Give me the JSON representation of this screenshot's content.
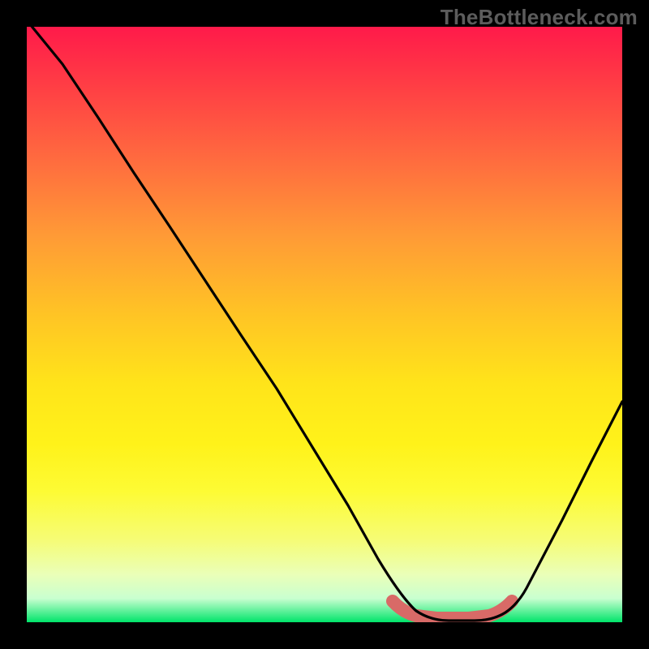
{
  "watermark": "TheBottleneck.com",
  "chart_data": {
    "type": "line",
    "title": "",
    "xlabel": "",
    "ylabel": "",
    "xlim": [
      0,
      100
    ],
    "ylim": [
      0,
      100
    ],
    "series": [
      {
        "name": "bottleneck-curve",
        "x": [
          0,
          6,
          12,
          18,
          24,
          30,
          36,
          42,
          48,
          54,
          59,
          63,
          67,
          71,
          75,
          79,
          82,
          86,
          90,
          94,
          100
        ],
        "values": [
          100,
          93,
          84,
          75,
          66,
          57,
          48,
          39,
          29,
          19,
          10,
          4,
          1,
          0,
          0,
          0,
          2,
          8,
          17,
          27,
          46
        ]
      }
    ],
    "highlight_region": {
      "name": "optimal-band",
      "x_start": 62,
      "x_end": 81,
      "color": "#d86a67"
    },
    "gradient_stops": [
      {
        "pos": 0,
        "color": "#ff1a4a"
      },
      {
        "pos": 22,
        "color": "#ff6a3f"
      },
      {
        "pos": 48,
        "color": "#ffc325"
      },
      {
        "pos": 70,
        "color": "#fff21a"
      },
      {
        "pos": 92,
        "color": "#eaffb8"
      },
      {
        "pos": 100,
        "color": "#00e46a"
      }
    ]
  }
}
